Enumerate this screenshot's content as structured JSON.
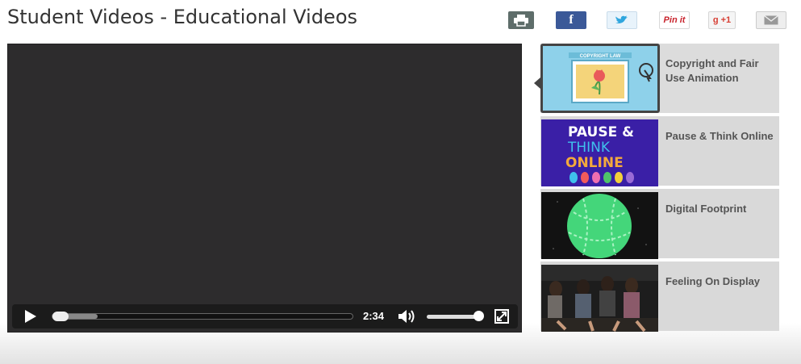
{
  "page": {
    "title": "Student Videos - Educational Videos"
  },
  "share": {
    "print_icon": "printer-icon",
    "facebook_label": "f",
    "twitter_icon": "twitter-bird-icon",
    "pinterest_label": "Pin it",
    "googleplus_label": "g +1",
    "email_icon": "envelope-icon"
  },
  "player": {
    "time": "2:34",
    "progress": 0.15,
    "volume": 0.9,
    "play_icon": "play-icon",
    "volume_icon": "volume-icon",
    "fullscreen_icon": "fullscreen-icon"
  },
  "playlist": [
    {
      "title": "Copyright and Fair Use Animation",
      "active": true,
      "thumb_caption": "COPYRIGHT LAW"
    },
    {
      "title": "Pause & Think Online",
      "active": false,
      "thumb_lines": [
        "PAUSE &",
        "THINK",
        "ONLINE"
      ]
    },
    {
      "title": "Digital Footprint",
      "active": false
    },
    {
      "title": "Feeling On Display",
      "active": false
    }
  ]
}
